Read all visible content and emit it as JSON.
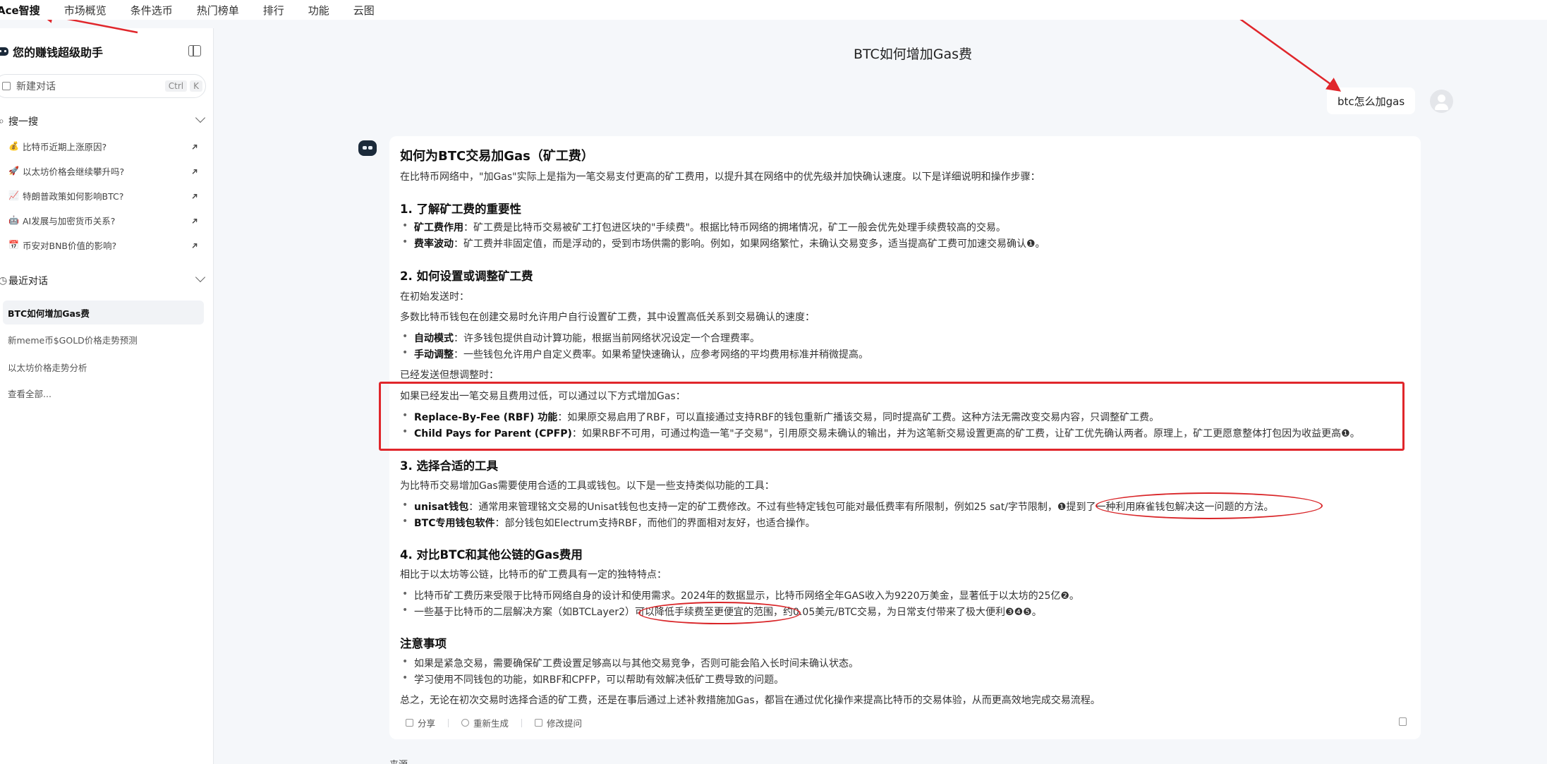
{
  "topnav": {
    "items": [
      "Ace智搜",
      "市场概览",
      "条件选币",
      "热门榜单",
      "排行",
      "功能",
      "云图"
    ]
  },
  "sidebar": {
    "assistant_title": "您的赚钱超级助手",
    "new_chat_label": "新建对话",
    "shortcut_ctrl": "Ctrl",
    "shortcut_key": "K",
    "search_section": "搜一搜",
    "hot_items": [
      {
        "icon": "money-bag-icon",
        "glyph": "💰",
        "label": "比特币近期上涨原因?"
      },
      {
        "icon": "rocket-icon",
        "glyph": "🚀",
        "label": "以太坊价格会继续攀升吗?"
      },
      {
        "icon": "chart-icon",
        "glyph": "📈",
        "label": "特朗普政策如何影响BTC?"
      },
      {
        "icon": "robot-icon",
        "glyph": "🤖",
        "label": "AI发展与加密货币关系?"
      },
      {
        "icon": "calendar-icon",
        "glyph": "📅",
        "label": "币安对BNB价值的影响?"
      }
    ],
    "recent_section": "最近对话",
    "recent_items": [
      "BTC如何增加Gas费",
      "新meme币$GOLD价格走势预测",
      "以太坊价格走势分析",
      "查看全部..."
    ]
  },
  "chat": {
    "title": "BTC如何增加Gas费",
    "user_message": "btc怎么加gas",
    "answer": {
      "heading": "如何为BTC交易加Gas（矿工费）",
      "intro": "在比特币网络中，\"加Gas\"实际上是指为一笔交易支付更高的矿工费用，以提升其在网络中的优先级并加快确认速度。以下是详细说明和操作步骤：",
      "s1_title": "1. 了解矿工费的重要性",
      "s1_b1_term": "矿工费作用",
      "s1_b1_text": "：矿工费是比特币交易被矿工打包进区块的\"手续费\"。根据比特币网络的拥堵情况，矿工一般会优先处理手续费较高的交易。",
      "s1_b2_term": "费率波动",
      "s1_b2_text": "：矿工费并非固定值，而是浮动的，受到市场供需的影响。例如，如果网络繁忙，未确认交易变多，适当提高矿工费可加速交易确认❶。",
      "s2_title": "2. 如何设置或调整矿工费",
      "s2_p1": "在初始发送时：",
      "s2_p2": "多数比特币钱包在创建交易时允许用户自行设置矿工费，其中设置高低关系到交易确认的速度：",
      "s2_b1_term": "自动模式",
      "s2_b1_text": "：许多钱包提供自动计算功能，根据当前网络状况设定一个合理费率。",
      "s2_b2_term": "手动调整",
      "s2_b2_text": "：一些钱包允许用户自定义费率。如果希望快速确认，应参考网络的平均费用标准并稍微提高。",
      "s2_p3": "已经发送但想调整时：",
      "s2_p4": "如果已经发出一笔交易且费用过低，可以通过以下方式增加Gas：",
      "s2_b3_term": "Replace-By-Fee (RBF) 功能",
      "s2_b3_text": "：如果原交易启用了RBF，可以直接通过支持RBF的钱包重新广播该交易，同时提高矿工费。这种方法无需改变交易内容，只调整矿工费。",
      "s2_b4_term": "Child Pays for Parent (CPFP)",
      "s2_b4_text": "：如果RBF不可用，可通过构造一笔\"子交易\"，引用原交易未确认的输出，并为这笔新交易设置更高的矿工费，让矿工优先确认两者。原理上，矿工更愿意整体打包因为收益更高❶。",
      "s3_title": "3. 选择合适的工具",
      "s3_p1": "为比特币交易增加Gas需要使用合适的工具或钱包。以下是一些支持类似功能的工具：",
      "s3_b1_term": "unisat钱包",
      "s3_b1_text": "：通常用来管理铭文交易的Unisat钱包也支持一定的矿工费修改。不过有些特定钱包可能对最低费率有所限制，例如25 sat/字节限制，❶提到了一种利用麻雀钱包解决这一问题的方法。",
      "s3_b2_term": "BTC专用钱包软件",
      "s3_b2_text": "：部分钱包如Electrum支持RBF，而他们的界面相对友好，也适合操作。",
      "s4_title": "4. 对比BTC和其他公链的Gas费用",
      "s4_p1": "相比于以太坊等公链，比特币的矿工费具有一定的独特特点：",
      "s4_b1": "比特币矿工费历来受限于比特币网络自身的设计和使用需求。2024年的数据显示，比特币网络全年GAS收入为9220万美金，显著低于以太坊的25亿❷。",
      "s4_b2": "一些基于比特币的二层解决方案（如BTCLayer2）可以降低手续费至更便宜的范围，约0.05美元/BTC交易，为日常支付带来了极大便利❸❹❺。",
      "notes_title": "注意事项",
      "notes_b1": "如果是紧急交易，需要确保矿工费设置足够高以与其他交易竞争，否则可能会陷入长时间未确认状态。",
      "notes_b2": "学习使用不同钱包的功能，如RBF和CPFP，可以帮助有效解决低矿工费导致的问题。",
      "conclusion": "总之，无论在初次交易时选择合适的矿工费，还是在事后通过上述补救措施加Gas，都旨在通过优化操作来提高比特币的交易体验，从而更高效地完成交易流程。"
    },
    "actions": {
      "share": "分享",
      "regenerate": "重新生成",
      "edit": "修改提问"
    },
    "source_label": "来源"
  },
  "annotation_color": "#e0262b"
}
